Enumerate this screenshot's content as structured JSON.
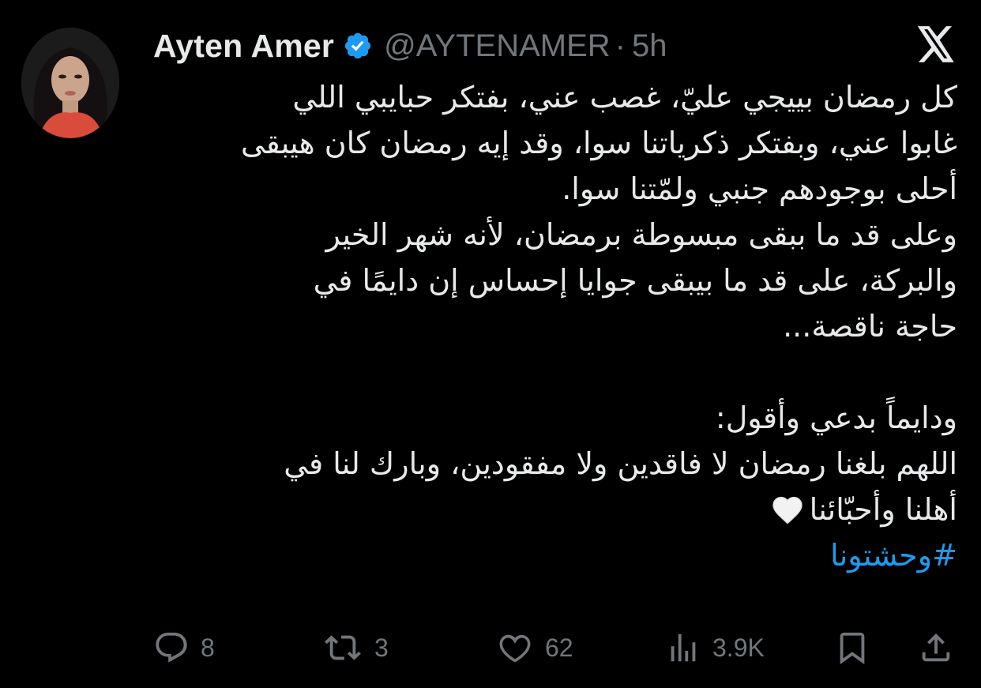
{
  "author": {
    "name": "Ayten Amer",
    "handle": "@AYTENAMER",
    "separator": "·",
    "time": "5h",
    "verified": true
  },
  "icons": {
    "avatar": "profile-photo",
    "verified": "verified-badge-icon",
    "logo": "x-logo-icon",
    "reply": "reply-icon",
    "retweet": "retweet-icon",
    "like": "like-icon",
    "views": "views-icon",
    "bookmark": "bookmark-icon",
    "share": "share-icon",
    "emoji": "white-heart-emoji"
  },
  "colors": {
    "background": "#000000",
    "text": "#e7e9ea",
    "muted": "#71767b",
    "accent": "#1d9bf0"
  },
  "tweet": {
    "lines": [
      "كل رمضان بييجي عليّ، غصب عني، بفتكر حبايبي اللي",
      "غابوا عني، وبفتكر ذكرياتنا سوا، وقد إيه رمضان كان هيبقى",
      "أحلى بوجودهم جنبي ولمّتنا سوا.",
      "وعلى قد ما ببقى مبسوطة برمضان، لأنه شهر الخير",
      "والبركة، على قد ما بيبقى جوايا إحساس إن دايمًا في",
      "حاجة ناقصة...",
      "",
      "ودايماً بدعي وأقول:",
      "اللهم بلغنا رمضان لا فاقدين ولا مفقودين، وبارك لنا في",
      "أهلنا وأحبّائنا"
    ],
    "hashtag": "#وحشتونا"
  },
  "actions": {
    "replies": "8",
    "retweets": "3",
    "likes": "62",
    "views": "3.9K"
  }
}
